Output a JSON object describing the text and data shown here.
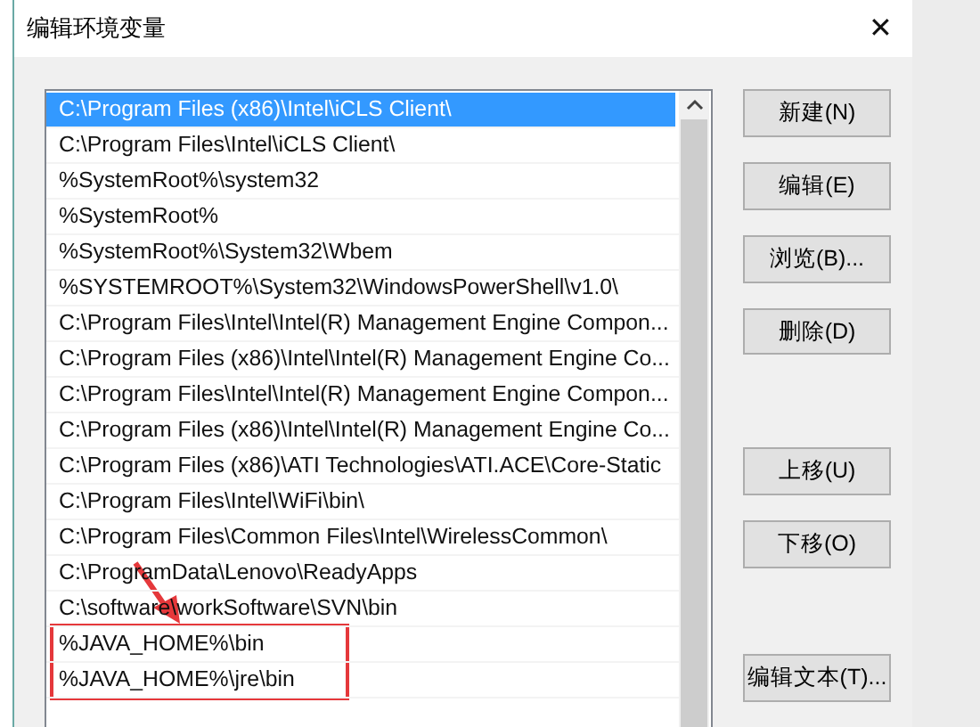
{
  "window": {
    "title": "编辑环境变量",
    "close": "✕"
  },
  "paths": [
    {
      "text": "C:\\Program Files (x86)\\Intel\\iCLS Client\\",
      "selected": true,
      "highlighted": false
    },
    {
      "text": "C:\\Program Files\\Intel\\iCLS Client\\",
      "selected": false,
      "highlighted": false
    },
    {
      "text": "%SystemRoot%\\system32",
      "selected": false,
      "highlighted": false
    },
    {
      "text": "%SystemRoot%",
      "selected": false,
      "highlighted": false
    },
    {
      "text": "%SystemRoot%\\System32\\Wbem",
      "selected": false,
      "highlighted": false
    },
    {
      "text": "%SYSTEMROOT%\\System32\\WindowsPowerShell\\v1.0\\",
      "selected": false,
      "highlighted": false
    },
    {
      "text": "C:\\Program Files\\Intel\\Intel(R) Management Engine Compon...",
      "selected": false,
      "highlighted": false
    },
    {
      "text": "C:\\Program Files (x86)\\Intel\\Intel(R) Management Engine Co...",
      "selected": false,
      "highlighted": false
    },
    {
      "text": "C:\\Program Files\\Intel\\Intel(R) Management Engine Compon...",
      "selected": false,
      "highlighted": false
    },
    {
      "text": "C:\\Program Files (x86)\\Intel\\Intel(R) Management Engine Co...",
      "selected": false,
      "highlighted": false
    },
    {
      "text": "C:\\Program Files (x86)\\ATI Technologies\\ATI.ACE\\Core-Static",
      "selected": false,
      "highlighted": false
    },
    {
      "text": "C:\\Program Files\\Intel\\WiFi\\bin\\",
      "selected": false,
      "highlighted": false
    },
    {
      "text": "C:\\Program Files\\Common Files\\Intel\\WirelessCommon\\",
      "selected": false,
      "highlighted": false
    },
    {
      "text": "C:\\ProgramData\\Lenovo\\ReadyApps",
      "selected": false,
      "highlighted": false
    },
    {
      "text": "C:\\software\\workSoftware\\SVN\\bin",
      "selected": false,
      "highlighted": false
    },
    {
      "text": "%JAVA_HOME%\\bin",
      "selected": false,
      "highlighted": true
    },
    {
      "text": "%JAVA_HOME%\\jre\\bin",
      "selected": false,
      "highlighted": true
    }
  ],
  "buttons": [
    {
      "label": "新建(N)"
    },
    {
      "label": "编辑(E)"
    },
    {
      "label": "浏览(B)..."
    },
    {
      "label": "删除(D)"
    },
    {
      "label": "上移(U)"
    },
    {
      "label": "下移(O)"
    },
    {
      "label": "编辑文本(T)..."
    }
  ]
}
